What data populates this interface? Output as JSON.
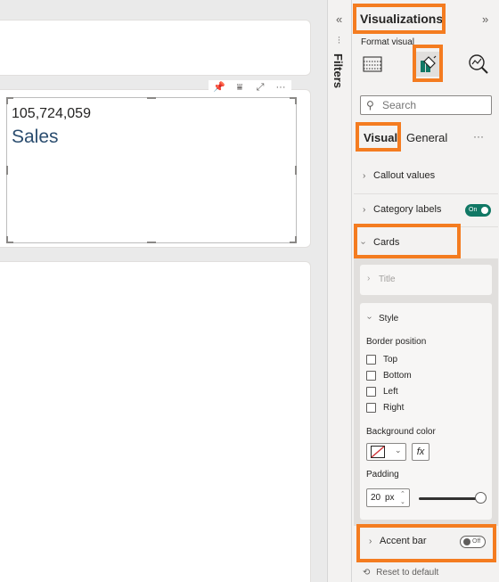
{
  "canvas": {
    "kpi_value": "105,724,059",
    "kpi_label": "Sales",
    "visual_tools": [
      "📌",
      "⩸",
      "⤢",
      "···"
    ]
  },
  "filters": {
    "collapse_glyph": "«",
    "label": "Filters"
  },
  "pane": {
    "title": "Visualizations",
    "expand_glyph": "»",
    "format_visual_label": "Format visual",
    "search_placeholder": "Search",
    "tabs": {
      "visual": "Visual",
      "general": "General",
      "more": "···"
    },
    "sections": {
      "callout_values": "Callout values",
      "category_labels": "Category labels",
      "category_labels_toggle": "On",
      "cards": "Cards",
      "accent_bar": "Accent bar",
      "accent_bar_toggle": "Off"
    },
    "cards_body": {
      "title_label": "Title",
      "style_label": "Style",
      "border_position_label": "Border position",
      "border_options": [
        "Top",
        "Bottom",
        "Left",
        "Right"
      ],
      "background_color_label": "Background color",
      "fx_label": "fx",
      "padding_label": "Padding",
      "padding_value": "20",
      "padding_unit": "px",
      "padding_slider_fraction": 1.0
    },
    "reset_label": "Reset to default"
  },
  "colors": {
    "highlight": "#f47c20",
    "toggle_on": "#117865",
    "kpi_label": "#2b4d6f"
  }
}
